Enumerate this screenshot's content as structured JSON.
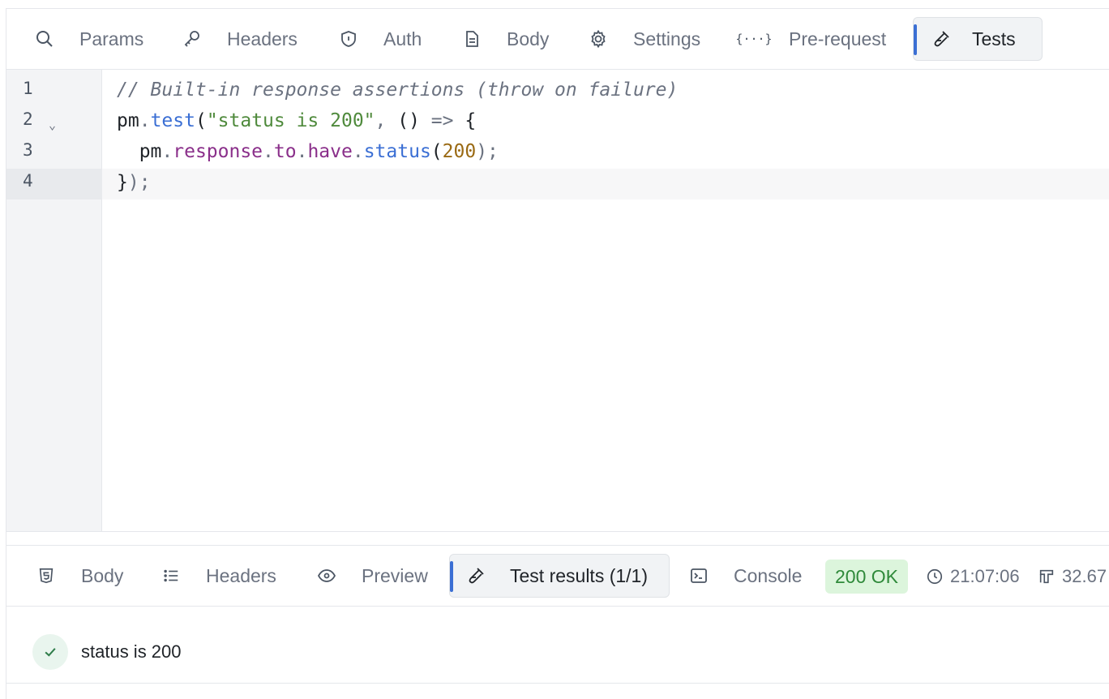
{
  "request_tabs": [
    {
      "id": "params",
      "label": "Params",
      "icon": "search-icon"
    },
    {
      "id": "headers",
      "label": "Headers",
      "icon": "key-icon"
    },
    {
      "id": "auth",
      "label": "Auth",
      "icon": "shield-icon"
    },
    {
      "id": "body",
      "label": "Body",
      "icon": "document-icon"
    },
    {
      "id": "settings",
      "label": "Settings",
      "icon": "gear-icon"
    },
    {
      "id": "prerequest",
      "label": "Pre-request",
      "icon": "braces-icon"
    },
    {
      "id": "tests",
      "label": "Tests",
      "icon": "flask-icon",
      "active": true
    }
  ],
  "editor": {
    "line_numbers": [
      "1",
      "2",
      "3",
      "4"
    ],
    "active_line": "4",
    "fold_marker": "⌄",
    "lines": [
      {
        "comment": "// Built-in response assertions (throw on failure)"
      },
      {
        "t1": "pm",
        "t2": ".",
        "t3": "test",
        "t4": "(",
        "t5": "\"status is 200\"",
        "t6": ",",
        "t7": " () ",
        "t8": "=>",
        "t9": " {"
      },
      {
        "t1": "  pm",
        "t2": ".",
        "t3": "response",
        "t4": ".",
        "t5": "to",
        "t6": ".",
        "t7": "have",
        "t8": ".",
        "t9": "status",
        "t10": "(",
        "t11": "200",
        "t12": ");"
      },
      {
        "t1": "}",
        "t2": ");"
      }
    ]
  },
  "response_tabs": [
    {
      "id": "body",
      "label": "Body",
      "icon": "html5-icon"
    },
    {
      "id": "headers",
      "label": "Headers",
      "icon": "list-icon"
    },
    {
      "id": "preview",
      "label": "Preview",
      "icon": "eye-icon"
    },
    {
      "id": "tests",
      "label": "Test results (1/1)",
      "icon": "flask-icon",
      "active": true
    },
    {
      "id": "console",
      "label": "Console",
      "icon": "terminal-icon"
    }
  ],
  "response_meta": {
    "status": "200 OK",
    "status_color": "#2f8a3a",
    "time": "21:07:06",
    "size": "32.67"
  },
  "test_results": [
    {
      "name": "status is 200",
      "passed": true
    }
  ],
  "colors": {
    "accent": "#3b6fd4",
    "success_bg": "#dcf5dc"
  }
}
